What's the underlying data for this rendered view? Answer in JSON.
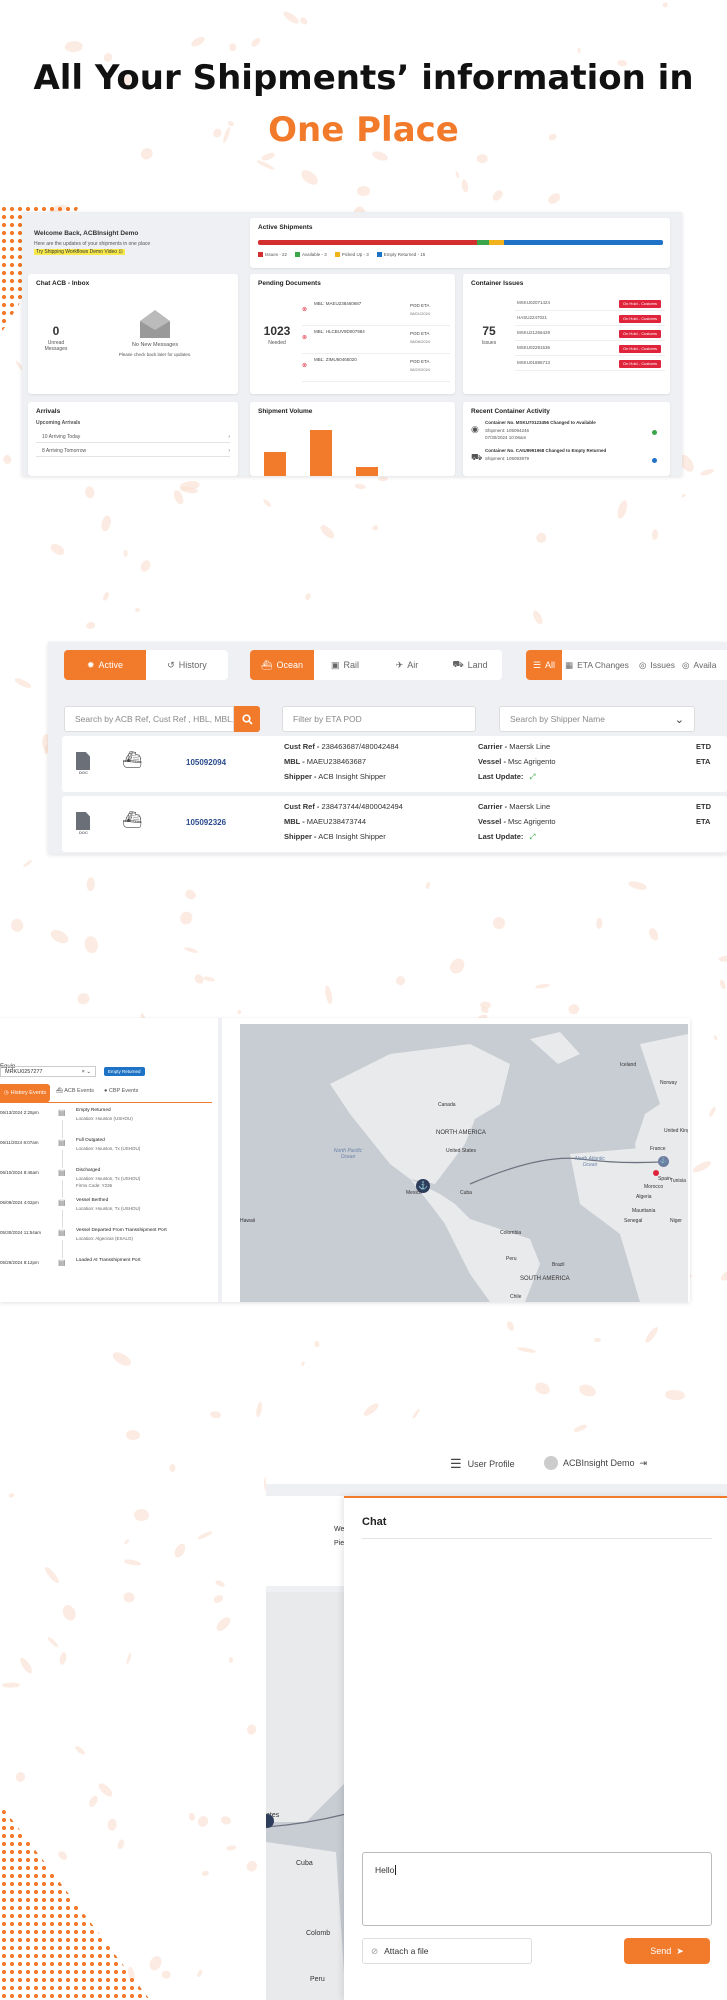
{
  "headline": {
    "line1": "All Your Shipments’ information in",
    "line2": "One Place"
  },
  "dashboard": {
    "welcome": {
      "title": "Welcome Back, ACBInsight Demo",
      "subtitle": "Here are the updates of your shipments in one place",
      "link": "Try Shipping Workflows Demo Video ⊡"
    },
    "active": {
      "title": "Active Shipments",
      "legend": [
        "Issues - 22",
        "Available - 3",
        "Picked Up - 3",
        "Empty Returned - 15"
      ]
    },
    "chat": {
      "title": "Chat ACB - Inbox",
      "count": "0",
      "count_label": "Unread Messages",
      "empty_title": "No New Messages",
      "empty_sub": "Please check back later for updates."
    },
    "pending": {
      "title": "Pending Documents",
      "count": "1023",
      "count_label": "Needed",
      "docs": [
        {
          "mbl": "MBL: MAEU238460687",
          "eta_label": "POD ETA",
          "eta": "08/01/2024"
        },
        {
          "mbl": "MBL: HLCBUV9D007984",
          "eta_label": "POD ETA",
          "eta": "08/06/2024"
        },
        {
          "mbl": "MBL: ZIMU60465020",
          "eta_label": "POD ETA",
          "eta": "08/20/2024"
        }
      ]
    },
    "issues": {
      "title": "Container Issues",
      "count": "75",
      "count_label": "Issues",
      "items": [
        {
          "id": "MSKU02071424",
          "tag": "On Hold - Customs"
        },
        {
          "id": "HASU2247021",
          "tag": "On Hold - Customs"
        },
        {
          "id": "MSKU21256429",
          "tag": "On Hold - Customs"
        },
        {
          "id": "MSKU02291536",
          "tag": "On Hold - Customs"
        },
        {
          "id": "MSKU01886713",
          "tag": "On Hold - Customs"
        }
      ]
    },
    "arrivals": {
      "title": "Arrivals",
      "subtitle": "Upcoming Arrivals",
      "items": [
        "10  Arriving Today",
        "8  Arriving Tomorrow"
      ]
    },
    "volume": {
      "title": "Shipment Volume"
    },
    "activity": {
      "title": "Recent Container Activity",
      "items": [
        {
          "line1": "Container No. MSKU70123456 Changed to Available",
          "line2": "Shipment: 105094246",
          "line3": "07/30/2024 10:06am"
        },
        {
          "line1": "Container No. CAIU9991968 Changed to Empty Returned",
          "line2": "Shipment: 105093979",
          "line3": ""
        }
      ]
    }
  },
  "shipments": {
    "tabs1": [
      "Active",
      "History"
    ],
    "tabs2": [
      "Ocean",
      "Rail",
      "Air",
      "Land"
    ],
    "tabs3": [
      "All",
      "ETA Changes",
      "Issues",
      "Availa"
    ],
    "search_placeholder": "Search by ACB Ref, Cust Ref , HBL, MBL, Container #",
    "eta_placeholder": "Filter by ETA POD",
    "shipper_placeholder": "Search by Shipper Name",
    "doc_label": "DOC",
    "rows": [
      {
        "ref": "105092094",
        "cust_ref_label": "Cust Ref -",
        "cust_ref": "238463687/480042484",
        "mbl_label": "MBL -",
        "mbl": "MAEU238463687",
        "shipper_label": "Shipper -",
        "shipper": "ACB Insight Shipper",
        "carrier_label": "Carrier -",
        "carrier": "Maersk Line",
        "vessel_label": "Vessel -",
        "vessel": "Msc Agrigento",
        "update_label": "Last Update:",
        "etd": "ETD",
        "eta": "ETA"
      },
      {
        "ref": "105092326",
        "cust_ref_label": "Cust Ref -",
        "cust_ref": "238473744/4800042494",
        "mbl_label": "MBL -",
        "mbl": "MAEU238473744",
        "shipper_label": "Shipper -",
        "shipper": "ACB Insight Shipper",
        "carrier_label": "Carrier -",
        "carrier": "Maersk Line",
        "vessel_label": "Vessel -",
        "vessel": "Msc Agrigento",
        "update_label": "Last Update:",
        "etd": "ETD",
        "eta": "ETA"
      }
    ]
  },
  "tracking": {
    "title": "Equip",
    "container": "MRKU0257277",
    "status_badge": "Empty Returned",
    "tabs": [
      "History Events",
      "ACB Events",
      "CBP Events"
    ],
    "events": [
      {
        "time": "06/13/2024 2:25pm",
        "title": "Empty Returned",
        "loc": "Location: Houston (USHOU)"
      },
      {
        "time": "06/11/2024 8:07am",
        "title": "Full Outgated",
        "loc": "Location: Houston, Tx (USHOU)"
      },
      {
        "time": "06/10/2024 8:46am",
        "title": "Discharged",
        "loc": "Location: Houston, Tx (USHOU)",
        "extra": "Firms Code: Y236"
      },
      {
        "time": "06/09/2024 4:02pm",
        "title": "Vessel Berthed",
        "loc": "Location: Houston, Tx (USHOU)"
      },
      {
        "time": "05/30/2024 11:54am",
        "title": "Vessel Departed From Transshipment Port",
        "loc": "Location: Algeciras (ESALG)"
      },
      {
        "time": "05/29/2024 8:12pm",
        "title": "Loaded At Transshipment Port",
        "loc": ""
      }
    ],
    "map_labels": [
      "Iceland",
      "Norway",
      "Canada",
      "United Kingdom",
      "France",
      "NORTH AMERICA",
      "United States",
      "North Pacific Ocean",
      "North Atlantic Ocean",
      "Spain",
      "Tunisia",
      "Morocco",
      "Algeria",
      "Mexico",
      "Cuba",
      "Mauritania",
      "Senegal",
      "Niger",
      "Colombia",
      "Peru",
      "Brazil",
      "SOUTH AMERICA",
      "Chile",
      "Hawaii"
    ]
  },
  "chat": {
    "user_profile": "User Profile",
    "user_name": "ACBInsight Demo",
    "title": "Chat",
    "message": "Hello",
    "attach": "Attach a file",
    "send": "Send",
    "bg_labels": [
      "We",
      "Pie",
      "ates",
      "Cuba",
      "Colomb",
      "Peru"
    ]
  },
  "colors": {
    "accent": "#f27a2b",
    "red": "#e0243b",
    "green": "#3aa54a",
    "yellow": "#f2b21b",
    "blue": "#1f73c6"
  }
}
